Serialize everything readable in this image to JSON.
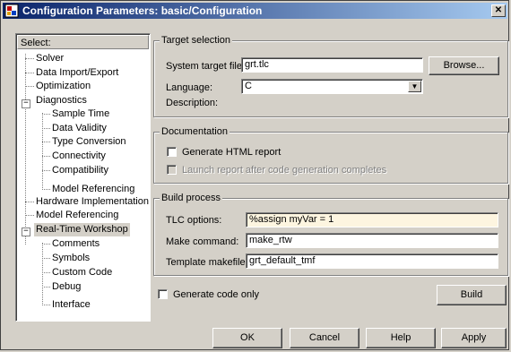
{
  "window": {
    "title": "Configuration Parameters: basic/Configuration",
    "close_glyph": "✕"
  },
  "tree": {
    "header": "Select:",
    "items": [
      {
        "label": "Solver"
      },
      {
        "label": "Data Import/Export"
      },
      {
        "label": "Optimization"
      },
      {
        "label": "Diagnostics"
      },
      {
        "label": "Sample Time"
      },
      {
        "label": "Data Validity"
      },
      {
        "label": "Type Conversion"
      },
      {
        "label": "Connectivity"
      },
      {
        "label": "Compatibility"
      },
      {
        "label": "Model Referencing"
      },
      {
        "label": "Hardware Implementation"
      },
      {
        "label": "Model Referencing"
      },
      {
        "label": "Real-Time Workshop"
      },
      {
        "label": "Comments"
      },
      {
        "label": "Symbols"
      },
      {
        "label": "Custom Code"
      },
      {
        "label": "Debug"
      },
      {
        "label": "Interface"
      }
    ],
    "selected": "Real-Time Workshop"
  },
  "target": {
    "title": "Target selection",
    "stf_label": "System target file:",
    "stf_value": "grt.tlc",
    "browse_label": "Browse...",
    "language_label": "Language:",
    "language_value": "C",
    "description_label": "Description:"
  },
  "documentation": {
    "title": "Documentation",
    "gen_html_label": "Generate HTML report",
    "launch_label": "Launch report after code generation completes"
  },
  "build": {
    "title": "Build process",
    "tlc_label": "TLC options:",
    "tlc_value": "%assign myVar = 1",
    "make_label": "Make command:",
    "make_value": "make_rtw",
    "template_label": "Template makefile:",
    "template_value": "grt_default_tmf"
  },
  "gen_code_only_label": "Generate code only",
  "build_button": "Build",
  "footer": {
    "ok": "OK",
    "cancel": "Cancel",
    "help": "Help",
    "apply": "Apply"
  },
  "colors": {
    "titlebar_start": "#0a246a",
    "titlebar_end": "#a6caf0",
    "face": "#d4d0c8",
    "highlight_field": "#fdf5e0"
  }
}
